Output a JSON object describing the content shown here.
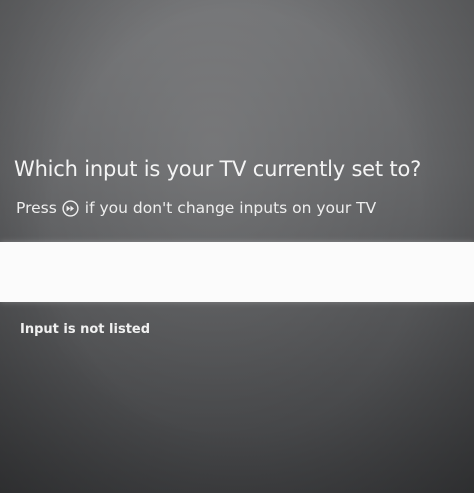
{
  "prompt": {
    "title": "Which input is your TV currently set to?",
    "subtitle_before_icon": "Press",
    "subtitle_icon": "fast-forward-button-icon",
    "subtitle_after_icon": "if you don't change inputs on your TV"
  },
  "options": {
    "selected_label": "",
    "not_listed_label": "Input is not listed"
  },
  "colors": {
    "background": "#5b5c5e",
    "text": "#f4f4f4",
    "selection": "#fbfbfb"
  }
}
